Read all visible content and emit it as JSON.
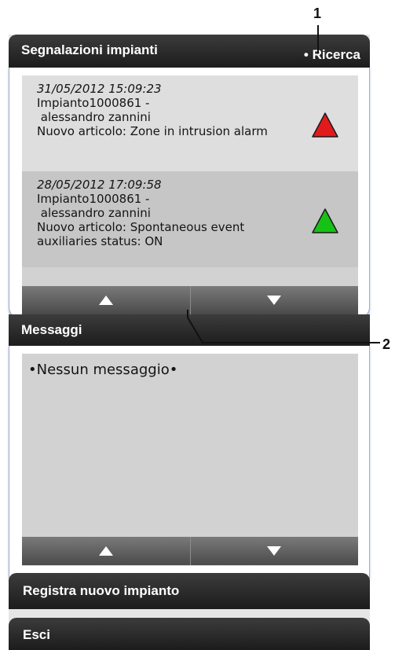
{
  "callouts": [
    "1",
    "2"
  ],
  "alerts_panel": {
    "title": "Segnalazioni impianti",
    "search_link": "• Ricerca",
    "items": [
      {
        "date": "31/05/2012 15:09:23",
        "plant": "Impianto1000861 -\n alessandro zannini",
        "message": "Nuovo articolo: Zone in intrusion alarm",
        "status_icon": "red-triangle-icon",
        "color": "#e11b1b",
        "background": "#dedede"
      },
      {
        "date": "28/05/2012 17:09:58",
        "plant": "Impianto1000861 -\n alessandro zannini",
        "message": "Nuovo articolo: Spontaneous event auxiliaries status: ON",
        "status_icon": "green-triangle-icon",
        "color": "#16c216",
        "background": "#c6c6c6"
      }
    ]
  },
  "messages_panel": {
    "title": "Messaggi",
    "empty_text": "•Nessun messaggio•"
  },
  "menu": {
    "register_label": "Registra nuovo impianto",
    "exit_label": "Esci"
  },
  "colors": {
    "header": "#2a2a2a",
    "panel_border": "#9aaccd",
    "list_background": "#d2d2d2",
    "arrow_button": "#5f5f5f"
  }
}
